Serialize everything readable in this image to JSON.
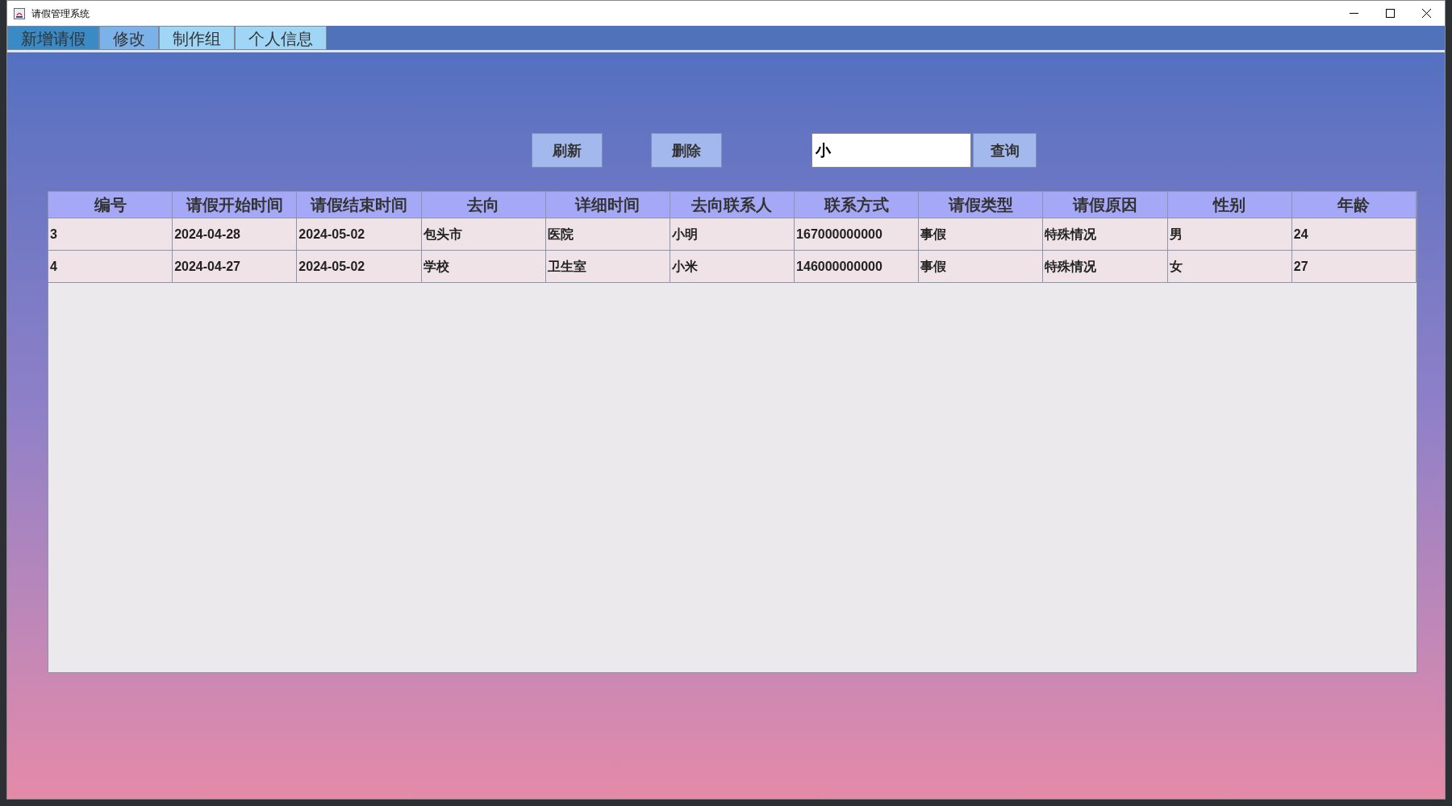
{
  "window": {
    "title": "请假管理系统"
  },
  "tabs": [
    {
      "label": "新增请假",
      "selected": true,
      "hovered": false
    },
    {
      "label": "修改",
      "selected": false,
      "hovered": true
    },
    {
      "label": "制作组",
      "selected": false,
      "hovered": false
    },
    {
      "label": "个人信息",
      "selected": false,
      "hovered": false
    }
  ],
  "toolbar": {
    "buttons": [
      "刷新",
      "删除"
    ],
    "search": {
      "value": "小"
    },
    "search_button": "查询"
  },
  "table": {
    "columns": [
      "编号",
      "请假开始时间",
      "请假结束时间",
      "去向",
      "详细时间",
      "去向联系人",
      "联系方式",
      "请假类型",
      "请假原因",
      "性别",
      "年龄"
    ],
    "rows": [
      [
        "3",
        "2024-04-28",
        "2024-05-02",
        "包头市",
        "医院",
        "小明",
        "167000000000",
        "事假",
        "特殊情况",
        "男",
        "24"
      ],
      [
        "4",
        "2024-04-27",
        "2024-05-02",
        "学校",
        "卫生室",
        "小米",
        "146000000000",
        "事假",
        "特殊情况",
        "女",
        "27"
      ]
    ]
  }
}
